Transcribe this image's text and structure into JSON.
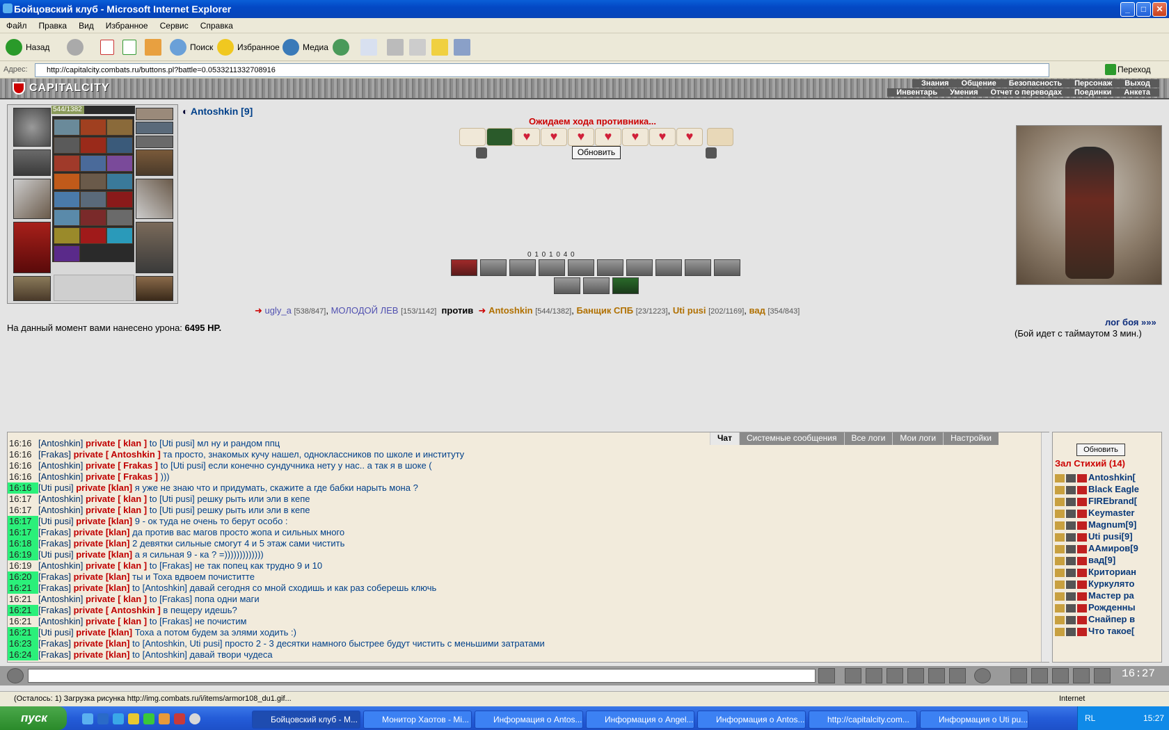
{
  "window": {
    "title": "Бойцовский клуб - Microsoft Internet Explorer"
  },
  "menu": [
    "Файл",
    "Правка",
    "Вид",
    "Избранное",
    "Сервис",
    "Справка"
  ],
  "toolbar": {
    "back": "Назад",
    "search": "Поиск",
    "favorites": "Избранное",
    "media": "Медиа"
  },
  "address": {
    "label": "Адрес:",
    "url": "http://capitalcity.combats.ru/buttons.pl?battle=0.0533211332708916",
    "go": "Переход"
  },
  "game": {
    "logo": "CAPITALCITY",
    "nav_row1": [
      "Знания",
      "Общение",
      "Безопасность",
      "Персонаж",
      "Выход"
    ],
    "nav_row2": [
      "Инвентарь",
      "Умения",
      "Отчет о переводах",
      "Поединки",
      "Анкета"
    ],
    "hp": "544/1382",
    "hp_fraction": 0.394,
    "character": "Antoshkin [9]",
    "waiting": "Ожидаем хода противника...",
    "refresh": "Обновить",
    "stats": "0  1  0  1  0  4  0",
    "vs": {
      "team1": [
        {
          "name": "ugly_a",
          "hp": "[538/847]"
        },
        {
          "name": "МОЛОДОЙ ЛЕВ",
          "hp": "[153/1142]"
        }
      ],
      "versus": "против",
      "team2": [
        {
          "name": "Antoshkin",
          "hp": "[544/1382]"
        },
        {
          "name": "Банщик СПБ",
          "hp": "[23/1223]"
        },
        {
          "name": "Uti pusi",
          "hp": "[202/1169]"
        },
        {
          "name": "вад",
          "hp": "[354/843]"
        }
      ]
    },
    "damage_label": "На данный момент вами нанесено урона:",
    "damage_value": "6495 HP.",
    "log_link": "лог боя »»»",
    "timeout": "(Бой идет с таймаутом 3 мин.)"
  },
  "chat": {
    "tabs": [
      "Чат",
      "Системные сообщения",
      "Все логи",
      "Мои логи",
      "Настройки"
    ],
    "lines": [
      {
        "t": "16:16",
        "hl": false,
        "nick": "[Antoshkin]",
        "priv": "private [ klan ]",
        "msg": "to [Uti pusi] мл ну и рандом ппц"
      },
      {
        "t": "16:16",
        "hl": false,
        "nick": "[Frakas]",
        "priv": "private [ Antoshkin ]",
        "msg": "та просто, знакомых кучу нашел, одноклассников по школе и институту"
      },
      {
        "t": "16:16",
        "hl": false,
        "nick": "[Antoshkin]",
        "priv": "private [ Frakas ]",
        "msg": "to [Uti pusi] если конечно сундучника нету у нас.. а так я в шоке ("
      },
      {
        "t": "16:16",
        "hl": false,
        "nick": "[Antoshkin]",
        "priv": "private [ Frakas ]",
        "msg": ")))"
      },
      {
        "t": "16:16",
        "hl": true,
        "nick": "[Uti pusi]",
        "priv": "private [klan]",
        "msg": "я уже не знаю что и придумать, скажите а где бабки нарыть мона ?"
      },
      {
        "t": "16:17",
        "hl": false,
        "nick": "[Antoshkin]",
        "priv": "private [ klan ]",
        "msg": "to [Uti pusi] решку рыть или эли в кепе"
      },
      {
        "t": "16:17",
        "hl": false,
        "nick": "[Antoshkin]",
        "priv": "private [ klan ]",
        "msg": "to [Uti pusi] решку рыть или эли в кепе"
      },
      {
        "t": "16:17",
        "hl": true,
        "nick": "[Uti pusi]",
        "priv": "private [klan]",
        "msg": "9 - ок туда не очень то берут особо :"
      },
      {
        "t": "16:17",
        "hl": true,
        "nick": "[Frakas]",
        "priv": "private [klan]",
        "msg": "да против вас магов просто жопа и сильных много"
      },
      {
        "t": "16:18",
        "hl": true,
        "nick": "[Frakas]",
        "priv": "private [klan]",
        "msg": "2 девятки сильные смогут 4 и 5 этаж сами чистить"
      },
      {
        "t": "16:19",
        "hl": true,
        "nick": "[Uti pusi]",
        "priv": "private [klan]",
        "msg": "а я сильная 9 - ка ? =)))))))))))))"
      },
      {
        "t": "16:19",
        "hl": false,
        "nick": "[Antoshkin]",
        "priv": "private [ klan ]",
        "msg": "to [Frakas] не так попец как трудно 9 и 10"
      },
      {
        "t": "16:20",
        "hl": true,
        "nick": "[Frakas]",
        "priv": "private [klan]",
        "msg": "ты и Тоха вдвоем почиститте"
      },
      {
        "t": "16:21",
        "hl": true,
        "nick": "[Frakas]",
        "priv": "private [klan]",
        "msg": "to [Antoshkin] давай сегодня со мной сходишь и как раз соберешь ключь"
      },
      {
        "t": "16:21",
        "hl": false,
        "nick": "[Antoshkin]",
        "priv": "private [ klan ]",
        "msg": "to [Frakas] попа одни маги"
      },
      {
        "t": "16:21",
        "hl": true,
        "nick": "[Frakas]",
        "priv": "private [ Antoshkin ]",
        "msg": "в пещеру идешь?"
      },
      {
        "t": "16:21",
        "hl": false,
        "nick": "[Antoshkin]",
        "priv": "private [ klan ]",
        "msg": "to [Frakas] не почистим"
      },
      {
        "t": "16:21",
        "hl": true,
        "nick": "[Uti pusi]",
        "priv": "private [klan]",
        "msg": "Тоха а потом будем за элями ходить :)"
      },
      {
        "t": "16:23",
        "hl": true,
        "nick": "[Frakas]",
        "priv": "private [klan]",
        "msg": "to [Antoshkin, Uti pusi] просто 2 - 3 десятки намного быстрее будут чистить с меньшими затратами"
      },
      {
        "t": "16:24",
        "hl": true,
        "nick": "[Frakas]",
        "priv": "private [klan]",
        "msg": "to [Antoshkin] давай твори чудеса"
      }
    ]
  },
  "users": {
    "refresh": "Обновить",
    "hall": "Зал Стихий (14)",
    "list": [
      "Antoshkin[",
      "Black Eagle",
      "FIREbrand[",
      "Keymaster",
      "Magnum[9]",
      "Uti pusi[9]",
      "AАмиров[9",
      "вад[9]",
      "Криториан",
      "Куркулято",
      "Мастер ра",
      "Рожденны",
      "Снайпер в",
      "Что такое["
    ]
  },
  "clock": "16:27",
  "status": {
    "text": "(Осталось: 1) Загрузка рисунка http://img.combats.ru/i/items/armor108_du1.gif...",
    "zone": "Internet"
  },
  "taskbar": {
    "start": "пуск",
    "tasks": [
      "Бойцовский клуб - M...",
      "Монитор Хаотов - Mi...",
      "Информация о Antos...",
      "Информация о Angel...",
      "Информация о Antos...",
      "http://capitalcity.com...",
      "Информация о Uti pu..."
    ],
    "lang": "RL",
    "time": "15:27"
  },
  "colors": {
    "accent": "#0348c4",
    "hl_time": "#2bf07a",
    "private": "#c00000"
  }
}
